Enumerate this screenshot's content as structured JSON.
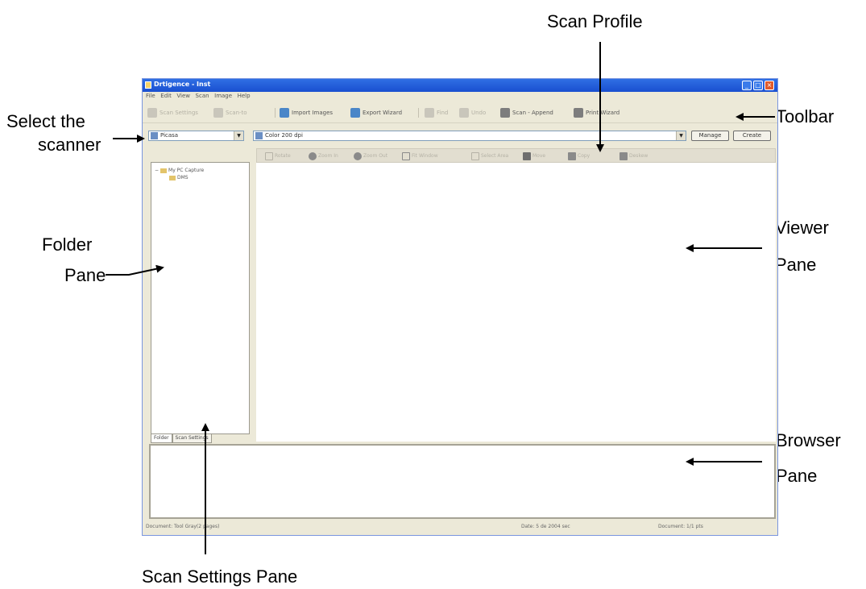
{
  "callouts": {
    "scan_profile": "Scan Profile",
    "toolbar": "Toolbar",
    "select_scanner_1": "Select the",
    "select_scanner_2": "scanner",
    "viewer_1": "Viewer",
    "viewer_2": "Pane",
    "folder_1": "Folder",
    "folder_2": "Pane",
    "browser_1": "Browser",
    "browser_2": "Pane",
    "scan_settings": "Scan Settings Pane"
  },
  "window": {
    "title": "Drtigence - Inst",
    "minimize_icon": "minimize-icon",
    "maximize_icon": "maximize-icon",
    "close_icon": "close-icon"
  },
  "menu": [
    "File",
    "Edit",
    "View",
    "Scan",
    "Image",
    "Help"
  ],
  "toolbar": {
    "scan_label": "Scan Settings",
    "scan_to_label": "Scan-to",
    "import_label": "Import Images",
    "export_label": "Export Wizard",
    "find_label": "Find",
    "undo_label": "Undo",
    "append_label": "Scan - Append",
    "print_label": "Print Wizard"
  },
  "scanner_select": {
    "value": "Picasa"
  },
  "profile_select": {
    "value": "Color 200 dpi"
  },
  "profile_buttons": {
    "manage": "Manage",
    "create": "Create"
  },
  "folder_tree": {
    "root": "My PC Capture",
    "child": "DMS"
  },
  "bottom_tabs": [
    "Folder",
    "Scan Settings"
  ],
  "viewer_toolbar": {
    "rotate": "Rotate",
    "zoom_in": "Zoom In",
    "zoom_out": "Zoom Out",
    "fit": "Fit Window",
    "select": "Select Area",
    "move": "Move",
    "copy": "Copy",
    "crop": "Deskew"
  },
  "status": {
    "left": "Document: Tool Gray(2 pages)",
    "middle": "Date: 5 de 2004 sec",
    "right": "Document: 1/1 pts"
  },
  "colors": {
    "titlebar": "#1a4fd0",
    "window_bg": "#ece9d8",
    "viewer_bg": "#ffffff"
  }
}
